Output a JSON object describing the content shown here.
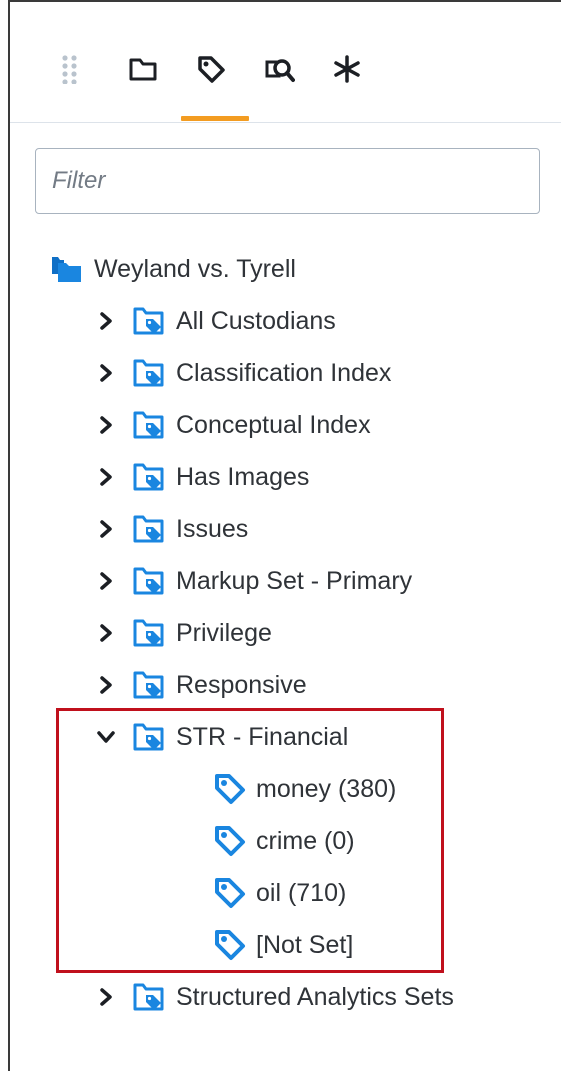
{
  "toolbar": {
    "icons": [
      "drag-handle-icon",
      "folder-icon",
      "tag-icon",
      "search-document-icon",
      "asterisk-icon"
    ],
    "active_tab": "tag-icon",
    "accent_color": "#f39c21"
  },
  "filter": {
    "placeholder": "Filter",
    "value": ""
  },
  "tree": {
    "root": {
      "label": "Weyland vs. Tyrell",
      "icon": "folder-tree-icon"
    },
    "items": [
      {
        "label": "All Custodians",
        "expanded": false
      },
      {
        "label": "Classification Index",
        "expanded": false
      },
      {
        "label": "Conceptual Index",
        "expanded": false
      },
      {
        "label": "Has Images",
        "expanded": false
      },
      {
        "label": "Issues",
        "expanded": false
      },
      {
        "label": "Markup Set - Primary",
        "expanded": false
      },
      {
        "label": "Privilege",
        "expanded": false
      },
      {
        "label": "Responsive",
        "expanded": false
      },
      {
        "label": "STR - Financial",
        "expanded": true
      },
      {
        "label": "Structured Analytics Sets",
        "expanded": false
      }
    ],
    "str_financial_children": [
      {
        "label": "money (380)"
      },
      {
        "label": "crime (0)"
      },
      {
        "label": "oil (710)"
      },
      {
        "label": "[Not Set]"
      }
    ]
  },
  "colors": {
    "icon_blue": "#1a86e0",
    "highlight_red": "#c0101c"
  }
}
